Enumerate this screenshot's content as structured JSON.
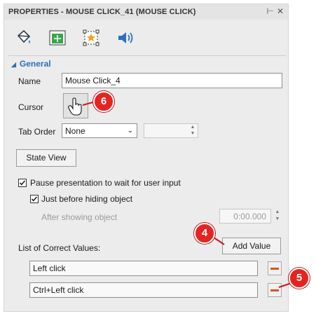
{
  "panel": {
    "title": "PROPERTIES - MOUSE CLICK_41 (MOUSE CLICK)",
    "pin_icon": "pin-icon",
    "close_icon": "close-icon"
  },
  "tabs": [
    {
      "icon": "paint-bucket-icon"
    },
    {
      "icon": "move-position-icon"
    },
    {
      "icon": "star-frame-icon"
    },
    {
      "icon": "speaker-icon"
    }
  ],
  "section": {
    "title": "General"
  },
  "name": {
    "label": "Name",
    "value": "Mouse Click_4"
  },
  "cursor": {
    "label": "Cursor",
    "icon": "hand-cursor-icon"
  },
  "tab_order": {
    "label": "Tab Order",
    "value": "None",
    "number": ""
  },
  "state_view": {
    "label": "State View"
  },
  "pause": {
    "label": "Pause presentation to wait for user input",
    "checked": true
  },
  "just_before": {
    "label": "Just before hiding object",
    "checked": true
  },
  "after_showing": {
    "label": "After showing object",
    "value": "0:00.000"
  },
  "correct_values": {
    "label": "List of Correct Values:",
    "add_label": "Add Value",
    "items": [
      "Left click",
      "Ctrl+Left click"
    ]
  },
  "callouts": [
    "6",
    "4",
    "5"
  ],
  "colors": {
    "accent": "#2f6fb6",
    "callout": "#e52421",
    "remove": "#e4501f"
  }
}
